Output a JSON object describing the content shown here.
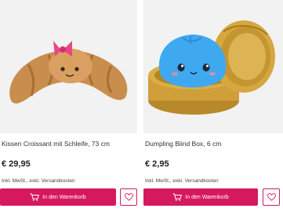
{
  "products": [
    {
      "title": "Kissen Croissant mit Schleife, 73 cm",
      "price": "€ 29,95",
      "tax_note": "Inkl. MwSt., exkl. Versandkosten",
      "cart_label": "In den Warenkorb"
    },
    {
      "title": "Dumpling Blind Box, 6 cm",
      "price": "€ 2,95",
      "tax_note": "Inkl. MwSt., exkl. Versandkosten",
      "cart_label": "In den Warenkorb"
    }
  ],
  "icons": {
    "cart": "cart-icon",
    "wishlist": "heart-icon"
  },
  "colors": {
    "accent": "#d6195f",
    "image_background": "#f2f2f2"
  }
}
